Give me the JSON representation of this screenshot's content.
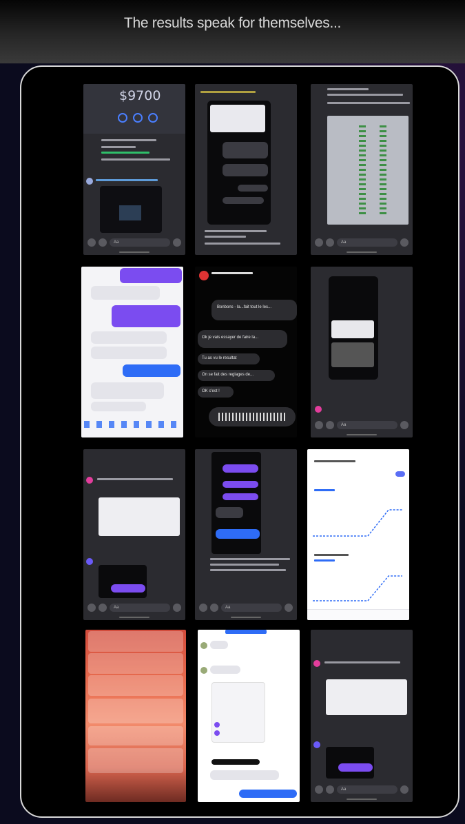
{
  "header": {
    "title": "The results speak for themselves..."
  },
  "screenshots": {
    "s1": {
      "amount": "$9700"
    },
    "s5": {
      "bubble_1": "Bonbons - la...fait tout le les...",
      "line_1": "Ok je vais essayer de faire la...",
      "line_2": "Tu as vu le resultat",
      "line_3": "On se fait des reglages de...",
      "line_4": "OK c'est !"
    },
    "input_placeholder": "Aa"
  }
}
